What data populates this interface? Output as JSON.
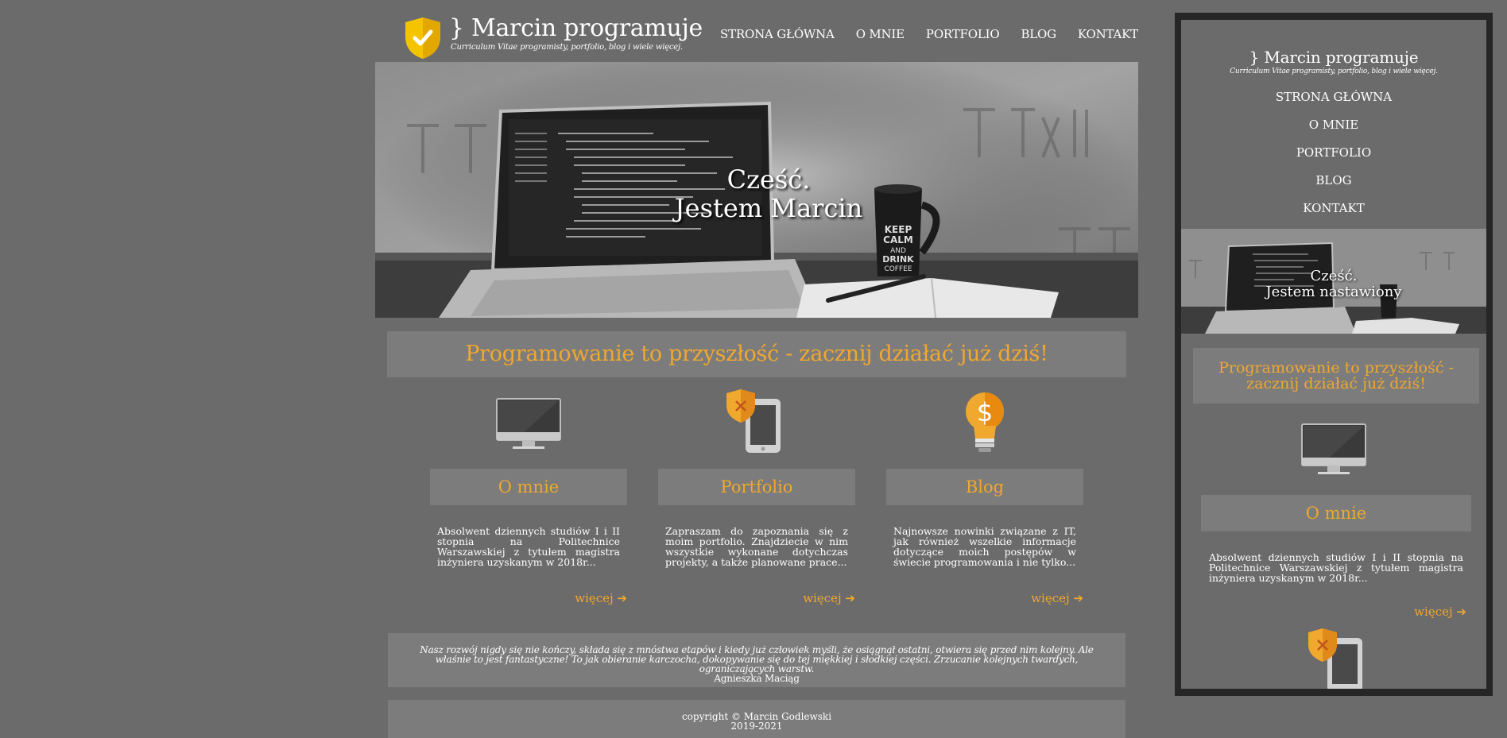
{
  "site": {
    "title": "} Marcin programuje",
    "subtitle": "Curriculum Vitae programisty, portfolio, blog i wiele więcej."
  },
  "nav": [
    "STRONA GŁÓWNA",
    "O MNIE",
    "PORTFOLIO",
    "BLOG",
    "KONTAKT"
  ],
  "hero": {
    "line1": "Cześć.",
    "line2": "Jestem Marcin"
  },
  "tagline": "Programowanie to przyszłość - zacznij działać już dziś!",
  "sections": [
    {
      "title": "O mnie",
      "icon": "monitor-icon",
      "text": "Absolwent dziennych studiów I i II stopnia na Politechnice Warszawskiej z tytułem magistra inżyniera uzyskanym w 2018r...",
      "more": "więcej ➔"
    },
    {
      "title": "Portfolio",
      "icon": "phone-shield-icon",
      "text": "Zapraszam do zapoznania się z moim portfolio. Znajdziecie w nim wszystkie wykonane dotychczas projekty, a także planowane prace...",
      "more": "więcej ➔"
    },
    {
      "title": "Blog",
      "icon": "lightbulb-dollar-icon",
      "text": "Najnowsze nowinki związane z IT, jak również wszelkie informacje dotyczące moich postępów w świecie programowania i nie tylko...",
      "more": "więcej ➔"
    }
  ],
  "quote": {
    "text": "Nasz rozwój nigdy się nie kończy, składa się z mnóstwa etapów i kiedy już człowiek myśli, że osiągnął ostatni, otwiera się przed nim kolejny. Ale właśnie to jest fantastyczne! To jak obieranie karczocha, dokopywanie się do tej miękkiej i słodkiej części. Zrzucanie kolejnych twardych, ograniczających warstw.",
    "author": "Agnieszka Maciąg"
  },
  "footer": {
    "line1": "copyright © Marcin Godlewski",
    "line2": "2019-2021"
  },
  "mobile": {
    "title": "} Marcin programuje",
    "subtitle": "Curriculum Vitae programisty, portfolio, blog i wiele więcej.",
    "nav": [
      "STRONA GŁÓWNA",
      "O MNIE",
      "PORTFOLIO",
      "BLOG",
      "KONTAKT"
    ],
    "hero_line1": "Cześć.",
    "hero_line2": "Jestem nastawiony",
    "tagline": "Programowanie to przyszłość - zacznij działać już dziś!",
    "section_title": "O mnie",
    "section_text": "Absolwent dziennych studiów I i II stopnia na Politechnice Warszawskiej z tytułem magistra inżyniera uzyskanym w 2018r...",
    "more": "więcej ➔"
  },
  "colors": {
    "background": "#6b6b6b",
    "accent": "#f0a82e",
    "panel": "#7c7c7c",
    "frame": "#262626"
  }
}
